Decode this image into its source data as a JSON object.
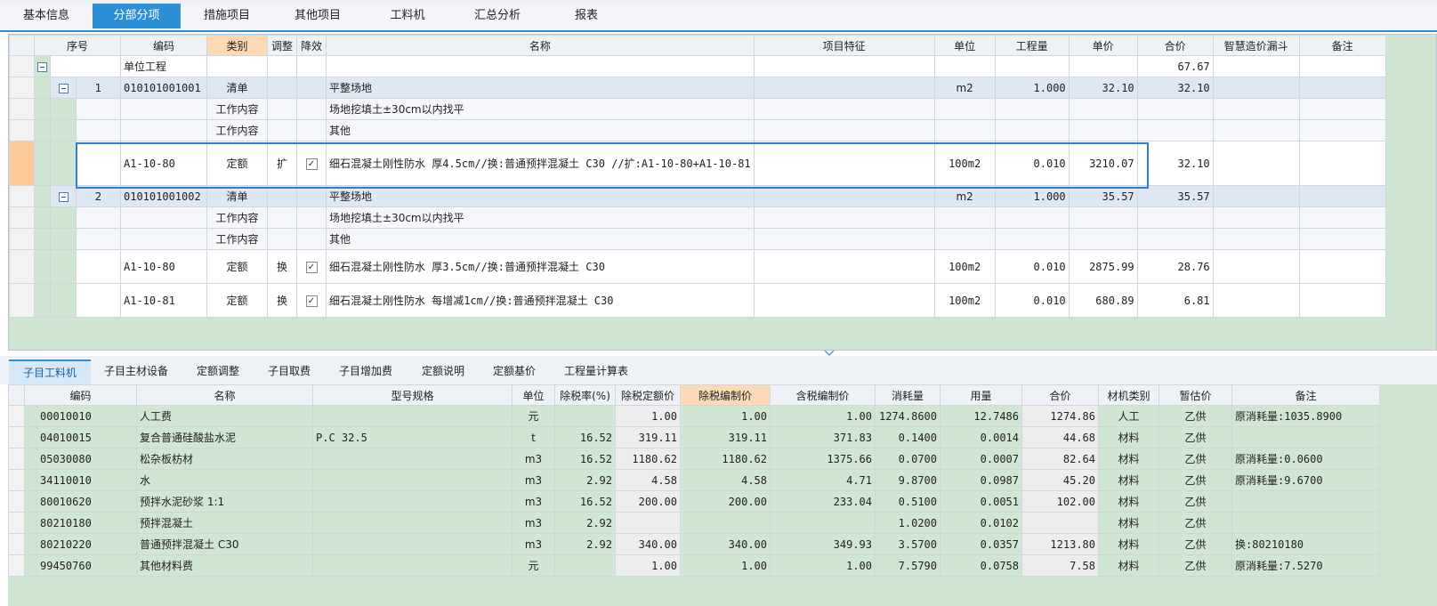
{
  "top_tabs": [
    "基本信息",
    "分部分项",
    "措施项目",
    "其他项目",
    "工料机",
    "汇总分析",
    "报表"
  ],
  "top_active": "分部分项",
  "upper": {
    "headers": {
      "seq": "序号",
      "code": "编码",
      "category": "类别",
      "adjust": "调整",
      "reduce": "降效",
      "name": "名称",
      "feature": "项目特征",
      "unit": "单位",
      "qty": "工程量",
      "price": "单价",
      "total": "合价",
      "smart": "智慧造价漏斗",
      "remark": "备注"
    },
    "rows": [
      {
        "level": "unit",
        "seq": "",
        "code": "单位工程",
        "category": "",
        "adjust": "",
        "checked": false,
        "name": "",
        "unit": "",
        "qty": "",
        "price": "",
        "total": "67.67"
      },
      {
        "level": "list",
        "seq": "1",
        "code": "010101001001",
        "category": "清单",
        "adjust": "",
        "checked": false,
        "name": "平整场地",
        "unit": "m2",
        "qty": "1.000",
        "price": "32.10",
        "total": "32.10"
      },
      {
        "level": "work",
        "seq": "",
        "code": "",
        "category": "工作内容",
        "adjust": "",
        "checked": false,
        "name": "场地挖填土±30cm以内找平",
        "unit": "",
        "qty": "",
        "price": "",
        "total": ""
      },
      {
        "level": "work",
        "seq": "",
        "code": "",
        "category": "工作内容",
        "adjust": "",
        "checked": false,
        "name": "其他",
        "unit": "",
        "qty": "",
        "price": "",
        "total": ""
      },
      {
        "level": "quota",
        "seq": "",
        "code": "A1-10-80",
        "category": "定额",
        "adjust": "扩",
        "checked": true,
        "name": "细石混凝土刚性防水 厚4.5cm//换:普通预拌混凝土 C30 //扩:A1-10-80+A1-10-81",
        "unit": "100m2",
        "qty": "0.010",
        "price": "3210.07",
        "total": "32.10"
      },
      {
        "level": "list",
        "seq": "2",
        "code": "010101001002",
        "category": "清单",
        "adjust": "",
        "checked": false,
        "name": "平整场地",
        "unit": "m2",
        "qty": "1.000",
        "price": "35.57",
        "total": "35.57"
      },
      {
        "level": "work",
        "seq": "",
        "code": "",
        "category": "工作内容",
        "adjust": "",
        "checked": false,
        "name": "场地挖填土±30cm以内找平",
        "unit": "",
        "qty": "",
        "price": "",
        "total": ""
      },
      {
        "level": "work",
        "seq": "",
        "code": "",
        "category": "工作内容",
        "adjust": "",
        "checked": false,
        "name": "其他",
        "unit": "",
        "qty": "",
        "price": "",
        "total": ""
      },
      {
        "level": "quota",
        "seq": "",
        "code": "A1-10-80",
        "category": "定额",
        "adjust": "换",
        "checked": true,
        "name": "细石混凝土刚性防水 厚3.5cm//换:普通预拌混凝土 C30",
        "unit": "100m2",
        "qty": "0.010",
        "price": "2875.99",
        "total": "28.76"
      },
      {
        "level": "quota",
        "seq": "",
        "code": "A1-10-81",
        "category": "定额",
        "adjust": "换",
        "checked": true,
        "name": "细石混凝土刚性防水 每增减1cm//换:普通预拌混凝土 C30",
        "unit": "100m2",
        "qty": "0.010",
        "price": "680.89",
        "total": "6.81"
      }
    ]
  },
  "lower_tabs": [
    "子目工料机",
    "子目主材设备",
    "定额调整",
    "子目取费",
    "子目增加费",
    "定额说明",
    "定额基价",
    "工程量计算表"
  ],
  "lower_active": "子目工料机",
  "lower": {
    "headers": {
      "code": "编码",
      "name": "名称",
      "spec": "型号规格",
      "unit": "单位",
      "tax_rate": "除税率(%)",
      "quota_price": "除税定额价",
      "prep_price": "除税编制价",
      "tax_price": "含税编制价",
      "consume": "消耗量",
      "usage": "用量",
      "total": "合价",
      "mat_type": "材机类别",
      "est_price": "暂估价",
      "remark": "备注"
    },
    "rows": [
      {
        "code": "00010010",
        "name": "人工费",
        "spec": "",
        "unit": "元",
        "tax_rate": "",
        "quota_price": "1.00",
        "prep_price": "1.00",
        "tax_price": "1.00",
        "consume": "1274.8600",
        "usage": "12.7486",
        "total": "1274.86",
        "mat_type": "人工",
        "est_price": "乙供",
        "remark": "原消耗量:1035.8900"
      },
      {
        "code": "04010015",
        "name": "复合普通硅酸盐水泥",
        "spec": "P.C 32.5",
        "unit": "t",
        "tax_rate": "16.52",
        "quota_price": "319.11",
        "prep_price": "319.11",
        "tax_price": "371.83",
        "consume": "0.1400",
        "usage": "0.0014",
        "total": "44.68",
        "mat_type": "材料",
        "est_price": "乙供",
        "remark": ""
      },
      {
        "code": "05030080",
        "name": "松杂板枋材",
        "spec": "",
        "unit": "m3",
        "tax_rate": "16.52",
        "quota_price": "1180.62",
        "prep_price": "1180.62",
        "tax_price": "1375.66",
        "consume": "0.0700",
        "usage": "0.0007",
        "total": "82.64",
        "mat_type": "材料",
        "est_price": "乙供",
        "remark": "原消耗量:0.0600"
      },
      {
        "code": "34110010",
        "name": "水",
        "spec": "",
        "unit": "m3",
        "tax_rate": "2.92",
        "quota_price": "4.58",
        "prep_price": "4.58",
        "tax_price": "4.71",
        "consume": "9.8700",
        "usage": "0.0987",
        "total": "45.20",
        "mat_type": "材料",
        "est_price": "乙供",
        "remark": "原消耗量:9.6700"
      },
      {
        "code": "80010620",
        "name": "预拌水泥砂浆 1:1",
        "spec": "",
        "unit": "m3",
        "tax_rate": "16.52",
        "quota_price": "200.00",
        "prep_price": "200.00",
        "tax_price": "233.04",
        "consume": "0.5100",
        "usage": "0.0051",
        "total": "102.00",
        "mat_type": "材料",
        "est_price": "乙供",
        "remark": ""
      },
      {
        "code": "80210180",
        "name": "预拌混凝土",
        "spec": "",
        "unit": "m3",
        "tax_rate": "2.92",
        "quota_price": "",
        "prep_price": "",
        "tax_price": "",
        "consume": "1.0200",
        "usage": "0.0102",
        "total": "",
        "mat_type": "材料",
        "est_price": "乙供",
        "remark": ""
      },
      {
        "code": "80210220",
        "name": "普通预拌混凝土 C30",
        "spec": "",
        "unit": "m3",
        "tax_rate": "2.92",
        "quota_price": "340.00",
        "prep_price": "340.00",
        "tax_price": "349.93",
        "consume": "3.5700",
        "usage": "0.0357",
        "total": "1213.80",
        "mat_type": "材料",
        "est_price": "乙供",
        "remark": "换:80210180"
      },
      {
        "code": "99450760",
        "name": "其他材料费",
        "spec": "",
        "unit": "元",
        "tax_rate": "",
        "quota_price": "1.00",
        "prep_price": "1.00",
        "tax_price": "1.00",
        "consume": "7.5790",
        "usage": "0.0758",
        "total": "7.58",
        "mat_type": "材料",
        "est_price": "乙供",
        "remark": "原消耗量:7.5270"
      }
    ]
  },
  "icons": {
    "expander": "collapse-icon",
    "checkbox": "checkbox-icon",
    "divider": "chevron-down-icon"
  }
}
